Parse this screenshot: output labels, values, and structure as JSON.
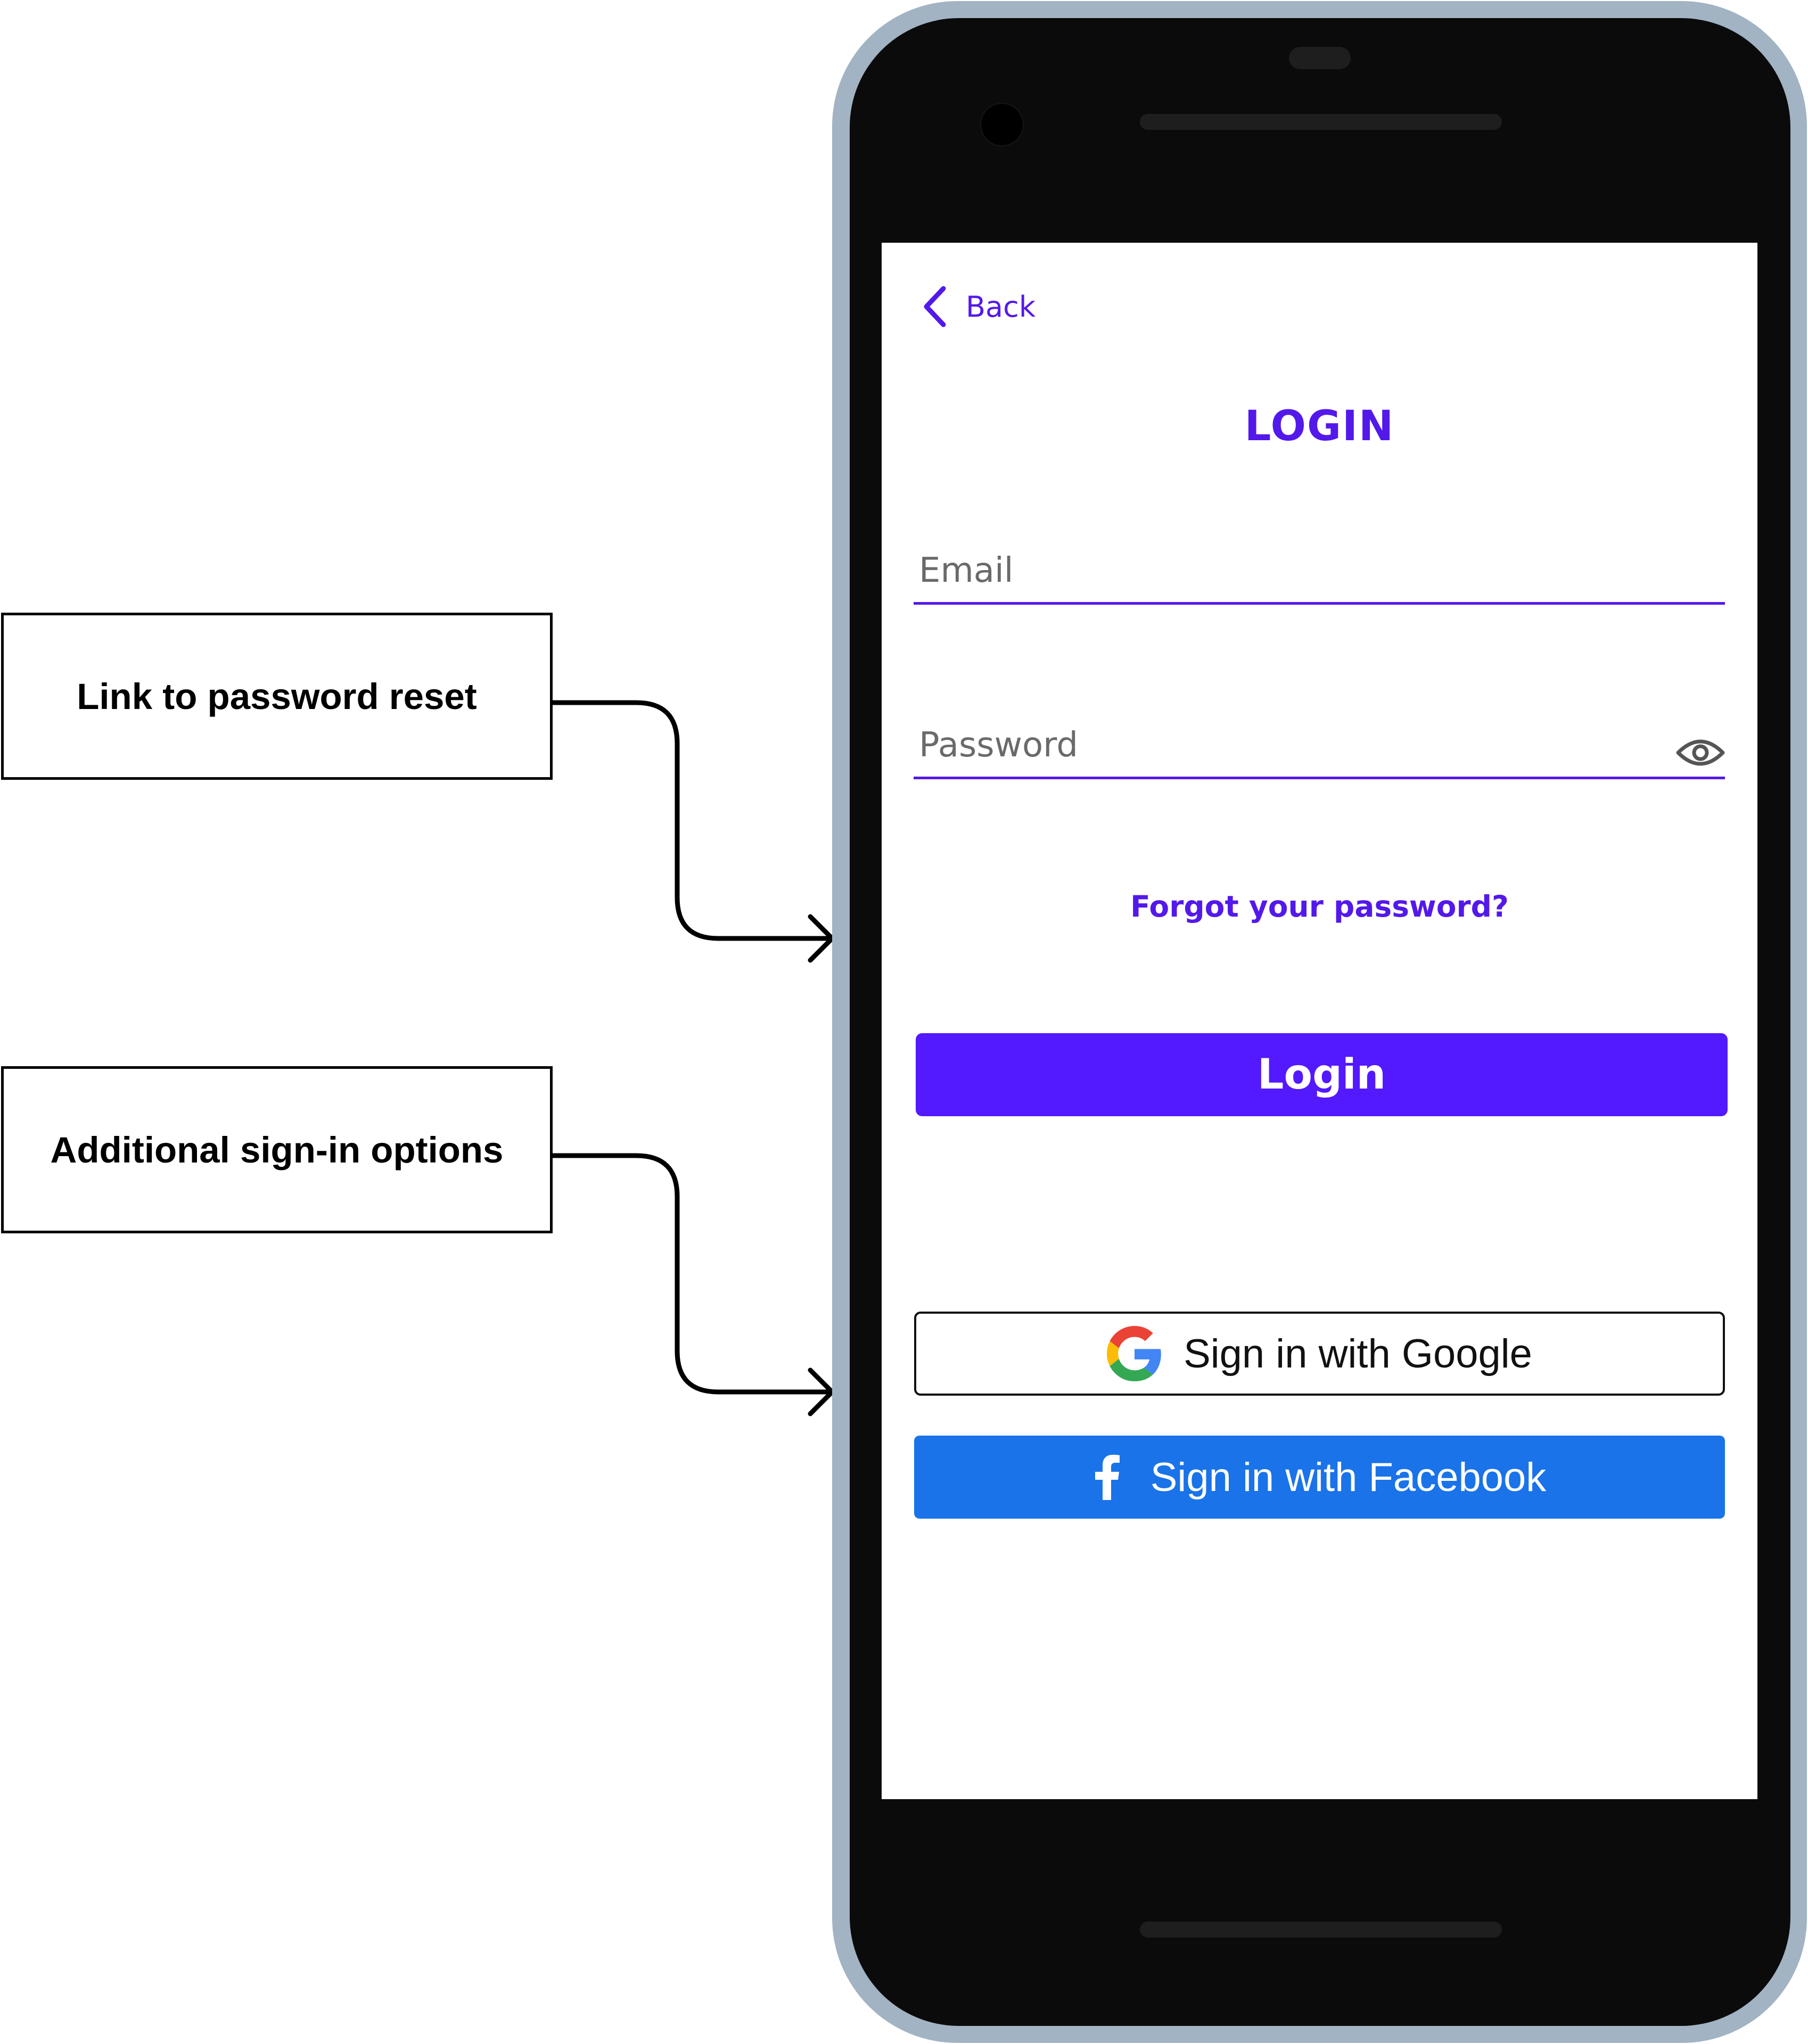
{
  "annotations": {
    "password_reset": "Link to password reset",
    "signin_options": "Additional sign-in options"
  },
  "screen": {
    "back_label": "Back",
    "title": "LOGIN",
    "email": {
      "placeholder": "Email",
      "value": ""
    },
    "password": {
      "placeholder": "Password",
      "value": ""
    },
    "forgot_password": "Forgot your password?",
    "login_button": "Login",
    "google_button": "Sign in with Google",
    "facebook_button": "Sign in with Facebook"
  },
  "icons": {
    "back": "chevron-left-icon",
    "password_visibility": "eye-icon",
    "google": "google-logo-icon",
    "facebook": "facebook-logo-icon"
  },
  "colors": {
    "accent": "#5319ea",
    "login_button": "#5319ff",
    "facebook_button": "#1a73e8",
    "phone_frame": "#a2b3c3",
    "phone_body": "#0b0b0b"
  }
}
